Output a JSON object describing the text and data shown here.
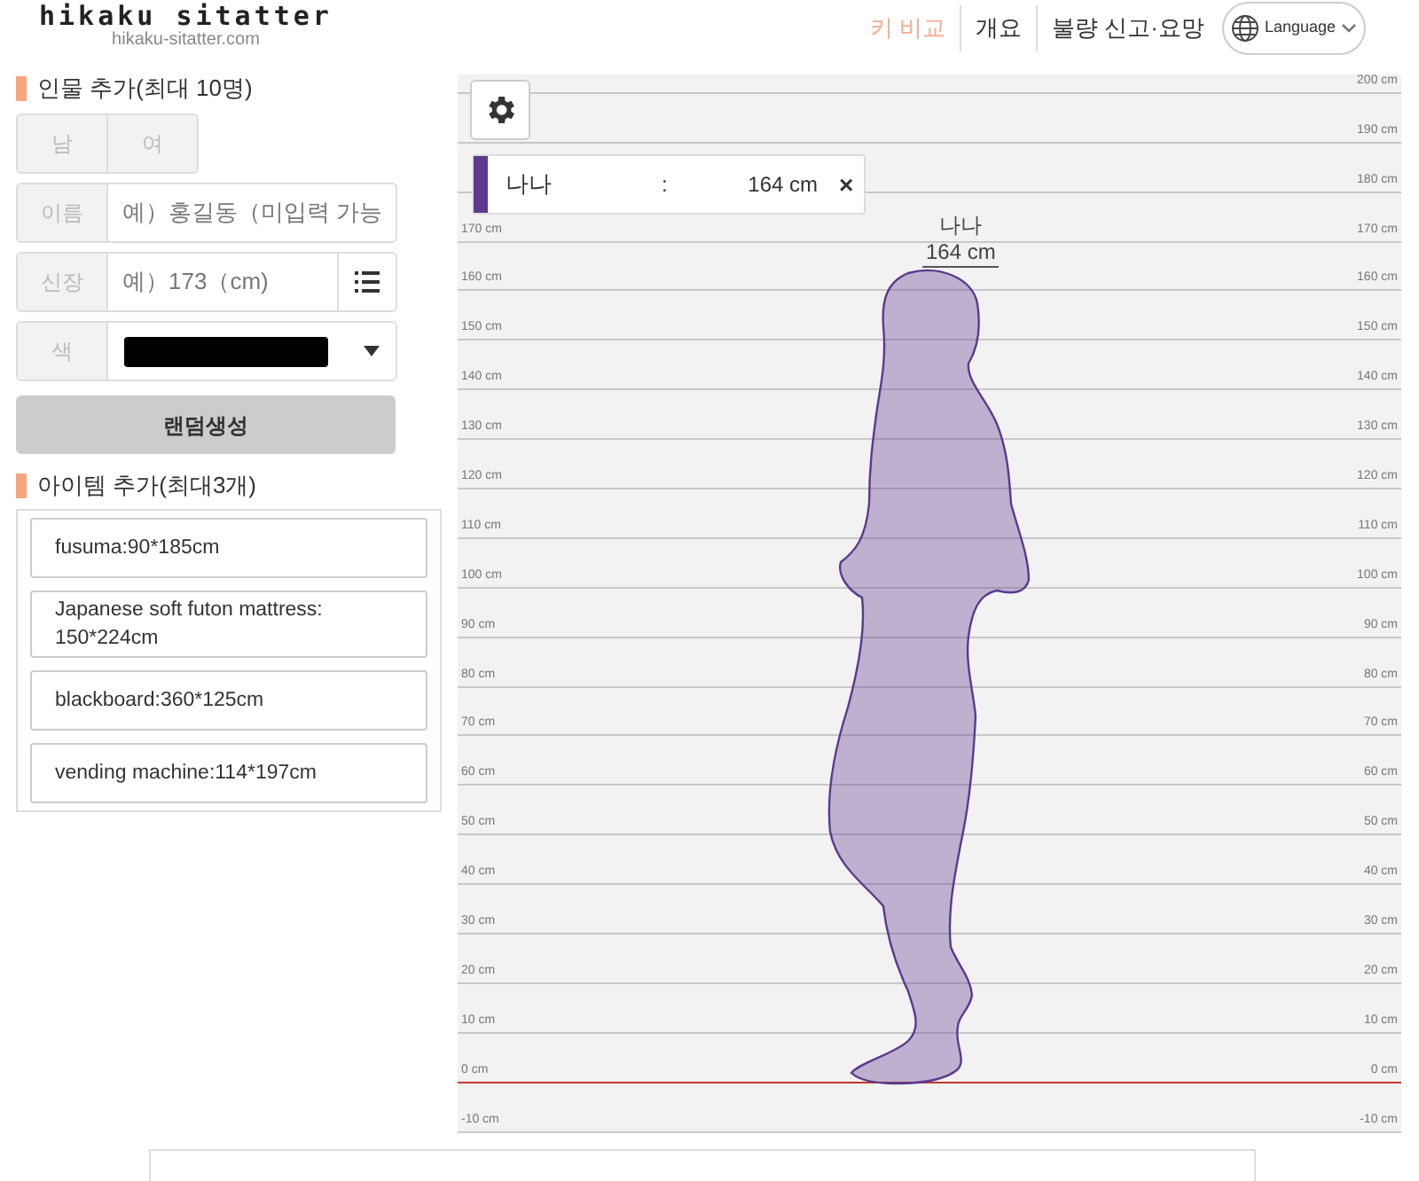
{
  "header": {
    "logo": "hikaku sitatter",
    "domain": "hikaku-sitatter.com",
    "nav": [
      {
        "label": "키 비교",
        "selected": true
      },
      {
        "label": "개요",
        "selected": false
      },
      {
        "label": "불량 신고·요망",
        "selected": false
      }
    ],
    "language": "Language"
  },
  "sidebar": {
    "person_title": "인물 추가(최대 10명)",
    "gender": [
      {
        "label": "남",
        "selected": false
      },
      {
        "label": "여",
        "selected": false
      }
    ],
    "name_field": {
      "label": "이름",
      "placeholder": "예）홍길동（미입력 가능"
    },
    "height_field": {
      "label": "신장",
      "placeholder": "예）173（cm)"
    },
    "color_field": {
      "label": "색",
      "color": "#000000"
    },
    "random_button": "랜덤생성",
    "items_title": "아이템 추가(최대3개)",
    "items": [
      "fusuma:90*185cm",
      "Japanese soft futon mattress: 150*224cm",
      "blackboard:360*125cm",
      "vending machine:114*197cm"
    ]
  },
  "chart": {
    "ticks": [
      {
        "right": "200 cm"
      },
      {
        "right": "190 cm"
      },
      {
        "right": "180 cm"
      },
      {
        "left": "170 cm",
        "right": "170 cm"
      },
      {
        "left": "160 cm",
        "right": "160 cm"
      },
      {
        "left": "150 cm",
        "right": "150 cm"
      },
      {
        "left": "140 cm",
        "right": "140 cm"
      },
      {
        "left": "130 cm",
        "right": "130 cm"
      },
      {
        "left": "120 cm",
        "right": "120 cm"
      },
      {
        "left": "110 cm",
        "right": "110 cm"
      },
      {
        "left": "100 cm",
        "right": "100 cm"
      },
      {
        "left": "90 cm",
        "right": "90 cm"
      },
      {
        "left": "80 cm",
        "right": "80 cm"
      },
      {
        "left": "70 cm",
        "right": "70 cm"
      },
      {
        "left": "60 cm",
        "right": "60 cm"
      },
      {
        "left": "50 cm",
        "right": "50 cm"
      },
      {
        "left": "40 cm",
        "right": "40 cm"
      },
      {
        "left": "30 cm",
        "right": "30 cm"
      },
      {
        "left": "20 cm",
        "right": "20 cm"
      },
      {
        "left": "10 cm",
        "right": "10 cm"
      },
      {
        "left": "0 cm",
        "right": "0 cm",
        "kind": "zero"
      },
      {
        "left": "-10 cm",
        "right": "-10 cm"
      }
    ],
    "legend": [
      {
        "name": "나나",
        "separator": ":",
        "height": "164 cm",
        "remove": "×",
        "color": "#5b3a8f"
      }
    ],
    "figures": [
      {
        "name": "나나",
        "height": "164 cm",
        "color": "#5b3a8f"
      }
    ]
  }
}
